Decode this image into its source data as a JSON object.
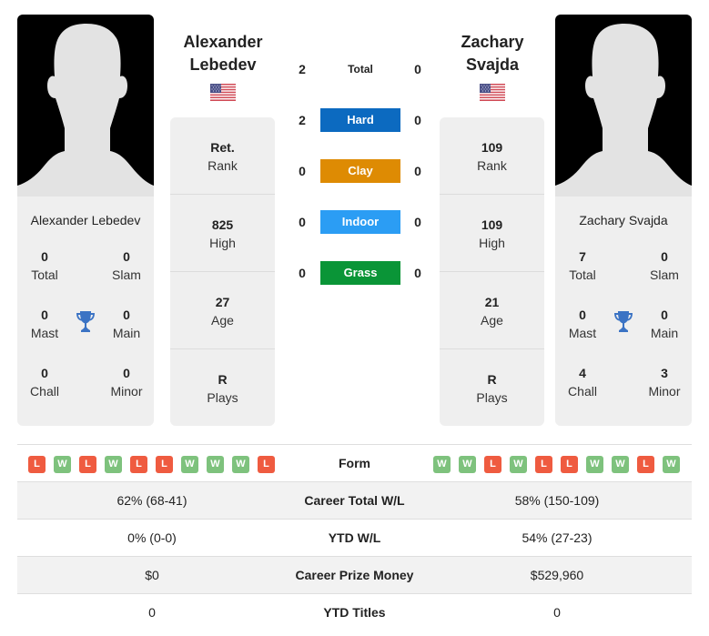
{
  "player1": {
    "name_head_line1": "Alexander",
    "name_head_line2": "Lebedev",
    "card_name": "Alexander Lebedev",
    "country_flag": "us-flag",
    "titles": {
      "total": {
        "value": "0",
        "label": "Total"
      },
      "slam": {
        "value": "0",
        "label": "Slam"
      },
      "mast": {
        "value": "0",
        "label": "Mast"
      },
      "main": {
        "value": "0",
        "label": "Main"
      },
      "chall": {
        "value": "0",
        "label": "Chall"
      },
      "minor": {
        "value": "0",
        "label": "Minor"
      }
    },
    "stats": [
      {
        "value": "Ret.",
        "label": "Rank"
      },
      {
        "value": "825",
        "label": "High"
      },
      {
        "value": "27",
        "label": "Age"
      },
      {
        "value": "R",
        "label": "Plays"
      }
    ],
    "form": [
      "L",
      "W",
      "L",
      "W",
      "L",
      "L",
      "W",
      "W",
      "W",
      "L"
    ]
  },
  "player2": {
    "name_head_line1": "Zachary",
    "name_head_line2": "Svajda",
    "card_name": "Zachary Svajda",
    "country_flag": "us-flag",
    "titles": {
      "total": {
        "value": "7",
        "label": "Total"
      },
      "slam": {
        "value": "0",
        "label": "Slam"
      },
      "mast": {
        "value": "0",
        "label": "Mast"
      },
      "main": {
        "value": "0",
        "label": "Main"
      },
      "chall": {
        "value": "4",
        "label": "Chall"
      },
      "minor": {
        "value": "3",
        "label": "Minor"
      }
    },
    "stats": [
      {
        "value": "109",
        "label": "Rank"
      },
      {
        "value": "109",
        "label": "High"
      },
      {
        "value": "21",
        "label": "Age"
      },
      {
        "value": "R",
        "label": "Plays"
      }
    ],
    "form": [
      "W",
      "W",
      "L",
      "W",
      "L",
      "L",
      "W",
      "W",
      "L",
      "W"
    ]
  },
  "h2h": [
    {
      "label": "Total",
      "left": "2",
      "right": "0",
      "color": ""
    },
    {
      "label": "Hard",
      "left": "2",
      "right": "0",
      "color": "#0c6ac0"
    },
    {
      "label": "Clay",
      "left": "0",
      "right": "0",
      "color": "#de8b03"
    },
    {
      "label": "Indoor",
      "left": "0",
      "right": "0",
      "color": "#2b9df4"
    },
    {
      "label": "Grass",
      "left": "0",
      "right": "0",
      "color": "#0a9537"
    }
  ],
  "comparison": {
    "form_label": "Form",
    "rows": [
      {
        "label": "Career Total W/L",
        "left": "62% (68-41)",
        "right": "58% (150-109)"
      },
      {
        "label": "YTD W/L",
        "left": "0% (0-0)",
        "right": "54% (27-23)"
      },
      {
        "label": "Career Prize Money",
        "left": "$0",
        "right": "$529,960"
      },
      {
        "label": "YTD Titles",
        "left": "0",
        "right": "0"
      }
    ]
  },
  "colors": {
    "win": "#7ec27d",
    "loss": "#ef5b40",
    "trophy": "#3b73c4"
  }
}
